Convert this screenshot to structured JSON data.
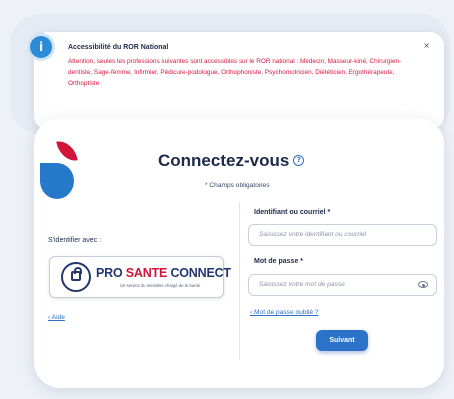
{
  "banner": {
    "icon": "info-icon",
    "title": "Accessibilité du ROR National",
    "text": "Attention, seules les professions suivantes sont accessibles sur le ROR national : Médecin, Masseur-kiné, Chirurgien-dentiste, Sage-femme, Infirmier, Pédicure-podologue, Orthophoniste, Psychomotricien, Diététicien, Ergothérapeute, Orthoptiste",
    "close": "×",
    "title_color": "#1d2a4a",
    "text_color": "#d6193f"
  },
  "login": {
    "title": "Connectez-vous",
    "help_glyph": "?",
    "required_note": "* Champs obligatoires",
    "identify_label": "S'identifier avec :",
    "psc": {
      "brand_pro": "PRO",
      "brand_sante": "SANTE",
      "brand_connect": "CONNECT",
      "subtitle": "Un service du ministère chargé de la Santé"
    },
    "aide_link": "Aide",
    "id_label": "Identifiant ou courriel *",
    "id_placeholder": "Saisissez votre identifiant ou courriel",
    "pwd_label": "Mot de passe *",
    "pwd_placeholder": "Saisissez votre mot de passe",
    "forgot_link": "Mot de passe oublié ?",
    "submit": "Suivant",
    "accent_color": "#2c72c9",
    "brand_red": "#d2143a"
  }
}
